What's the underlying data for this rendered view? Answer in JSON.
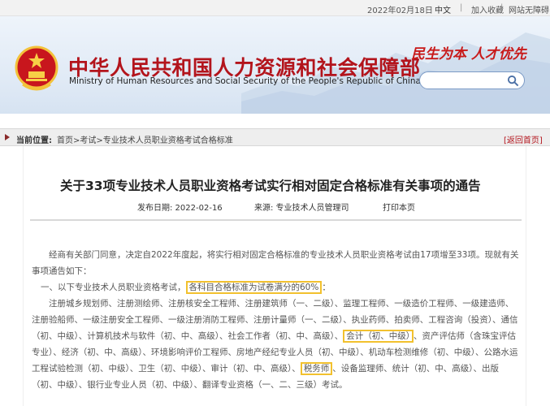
{
  "topbar": {
    "date": "2022年02月18日",
    "lang": "中文",
    "separator": "|",
    "favorite": "加入收藏",
    "accessible": "网站无障碍"
  },
  "header": {
    "title_cn": "中华人民共和国人力资源和社会保障部",
    "title_en": "Ministry of Human Resources and Social Security of the People's Republic of China",
    "slogan": "民生为本 人才优先",
    "search_placeholder": ""
  },
  "breadcrumb": {
    "label": "当前位置:",
    "path": "首页>考试>专业技术人员职业资格考试合格标准",
    "back": "[返回首页]"
  },
  "article": {
    "title": "关于33项专业技术人员职业资格考试实行相对固定合格标准有关事项的通告",
    "publish_date": "发布日期:  2022-02-16",
    "source": "来源:  专业技术人员管理司",
    "print": "打印本页",
    "p1": "经商有关部门同意，决定自2022年度起，将实行相对固定合格标准的专业技术人员职业资格考试由17项增至33项。现就有关事项通告如下：",
    "p2_prefix": "一、以下专业技术人员职业资格考试，",
    "p2_highlight": "各科目合格标准为试卷满分的60%",
    "p2_suffix": "：",
    "p3_a": "注册城乡规划师、注册测绘师、注册核安全工程师、注册建筑师（一、二级）、监理工程师、一级造价工程师、一级建造师、注册验船师、一级注册安全工程师、一级注册消防工程师、注册计量师（一、二级）、执业药师、拍卖师、工程咨询（投资）、通信（初、中级）、计算机技术与软件（初、中、高级）、社会工作者（初、中、高级）、",
    "p3_hl1": "会计（初、中级）",
    "p3_b": "、资产评估师（含珠宝评估专业）、经济（初、中、高级）、环境影响评价工程师、房地产经纪专业人员（初、中级）、机动车检测维修（初、中级）、公路水运工程试验检测（初、中级）、卫生（初、中级）、审计（初、中、高级）、",
    "p3_hl2": "税务师",
    "p3_c": "、设备监理师、统计（初、中、高级）、出版（初、中级）、银行业专业人员（初、中级）、翻译专业资格（一、二、三级）考试。"
  },
  "colors": {
    "brand_red": "#b3141c",
    "highlight_border": "#f2c12e",
    "header_bg": "#dfe9f5"
  }
}
